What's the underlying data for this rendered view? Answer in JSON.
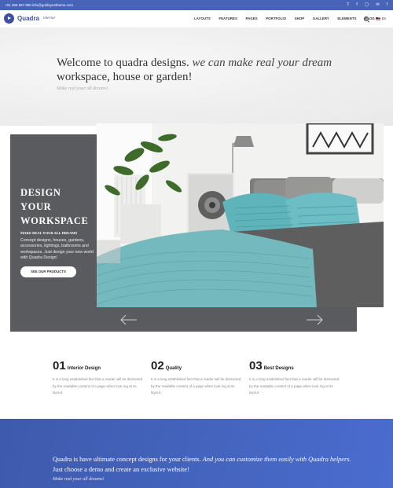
{
  "topbar": {
    "phone": "+01 256 567 890",
    "email": "info@goldeyestheme.com",
    "socials": [
      "twitter",
      "facebook",
      "instagram",
      "email",
      "facebook"
    ]
  },
  "header": {
    "logo_name": "Quadra",
    "logo_sub": "interior",
    "nav": [
      "LAYOUTS",
      "FEATURES",
      "PAGES",
      "PORTFOLIO",
      "SHOP",
      "GALLERY",
      "ELEMENTS",
      "BLOG"
    ],
    "language": "En"
  },
  "hero": {
    "heading_plain": "Welcome to quadra designs.",
    "heading_italic": "we can make real your dream",
    "heading_line2": "workspace, house or garden!",
    "tagline": "Make real your all dreams!"
  },
  "promo": {
    "title_lines": [
      "DESIGN",
      "YOUR",
      "WORKSPACE"
    ],
    "subtitle": "MAKE REAL YOUR ALL DREAMS",
    "description": "Concept designs, houses, gardens, accessories, lightings, bathrooms and workspaces. Just design your new world with Quadra Design!",
    "cta": "SEE OUR PRODUCTS"
  },
  "features": [
    {
      "num": "01",
      "title": "Interior Design",
      "desc": "It is a long established fact that a reader will be distracted by the readable content of a page when look ing at its layout."
    },
    {
      "num": "02",
      "title": "Quality",
      "desc": "It is a long established fact that a reader will be distracted by the readable content of a page when look ing at its layout."
    },
    {
      "num": "03",
      "title": "Best Designs",
      "desc": "It is a long established fact that a reader will be distracted by the readable content of a page when look ing at its layout."
    }
  ],
  "banner": {
    "text_plain": "Quadra is have ultimate concept designs for your clients.",
    "text_italic": "And you can customize them easily with Quadra helpers.",
    "text_end": "Just choose a demo and create an exclusive website!",
    "tagline": "Make real your all dreams!"
  },
  "colors": {
    "brand": "#3d4fa4",
    "topbar": "#4764b8",
    "promo_panel": "#5a5b5e",
    "bedspread": "#74b9bd"
  }
}
